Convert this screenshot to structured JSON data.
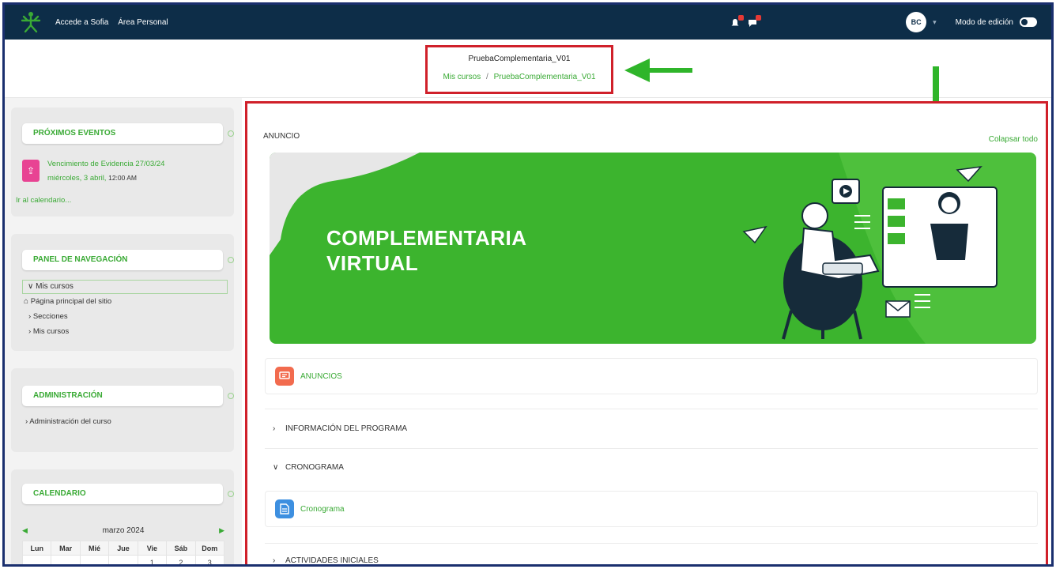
{
  "navbar": {
    "links": [
      "Accede a Sofia",
      "Área Personal"
    ],
    "avatar_initials": "BC",
    "edit_mode_label": "Modo de edición"
  },
  "header": {
    "course_title": "PruebaComplementaria_V01",
    "breadcrumb_root": "Mis cursos",
    "breadcrumb_sep": "/",
    "breadcrumb_current": "PruebaComplementaria_V01"
  },
  "sidebar": {
    "events": {
      "title": "PRÓXIMOS EVENTOS",
      "event_name": "Vencimiento de Evidencia 27/03/24",
      "event_date": "miércoles, 3 abril,",
      "event_time": "12:00 AM",
      "calendar_link": "Ir al calendario..."
    },
    "navigation": {
      "title": "PANEL DE NAVEGACIÓN",
      "items": [
        "Mis cursos",
        "Página principal del sitio",
        "Secciones",
        "Mis cursos"
      ]
    },
    "admin": {
      "title": "ADMINISTRACIÓN",
      "items": [
        "Administración del curso"
      ]
    },
    "calendar": {
      "title": "CALENDARIO",
      "month": "marzo 2024",
      "days": [
        "Lun",
        "Mar",
        "Mié",
        "Jue",
        "Vie",
        "Sáb",
        "Dom"
      ],
      "first_week": [
        "",
        "",
        "",
        "",
        "1",
        "2",
        "3"
      ]
    }
  },
  "main": {
    "section_title": "ANUNCIO",
    "collapse_all": "Colapsar todo",
    "banner_line1": "COMPLEMENTARIA",
    "banner_line2": "VIRTUAL",
    "announcements_label": "ANUNCIOS",
    "sections": [
      "INFORMACIÓN DEL PROGRAMA",
      "CRONOGRAMA",
      "ACTIVIDADES INICIALES"
    ],
    "schedule_label": "Cronograma"
  },
  "colors": {
    "navbar": "#0d2d48",
    "accent_green": "#3aaa35",
    "highlight_red": "#d0202a"
  }
}
